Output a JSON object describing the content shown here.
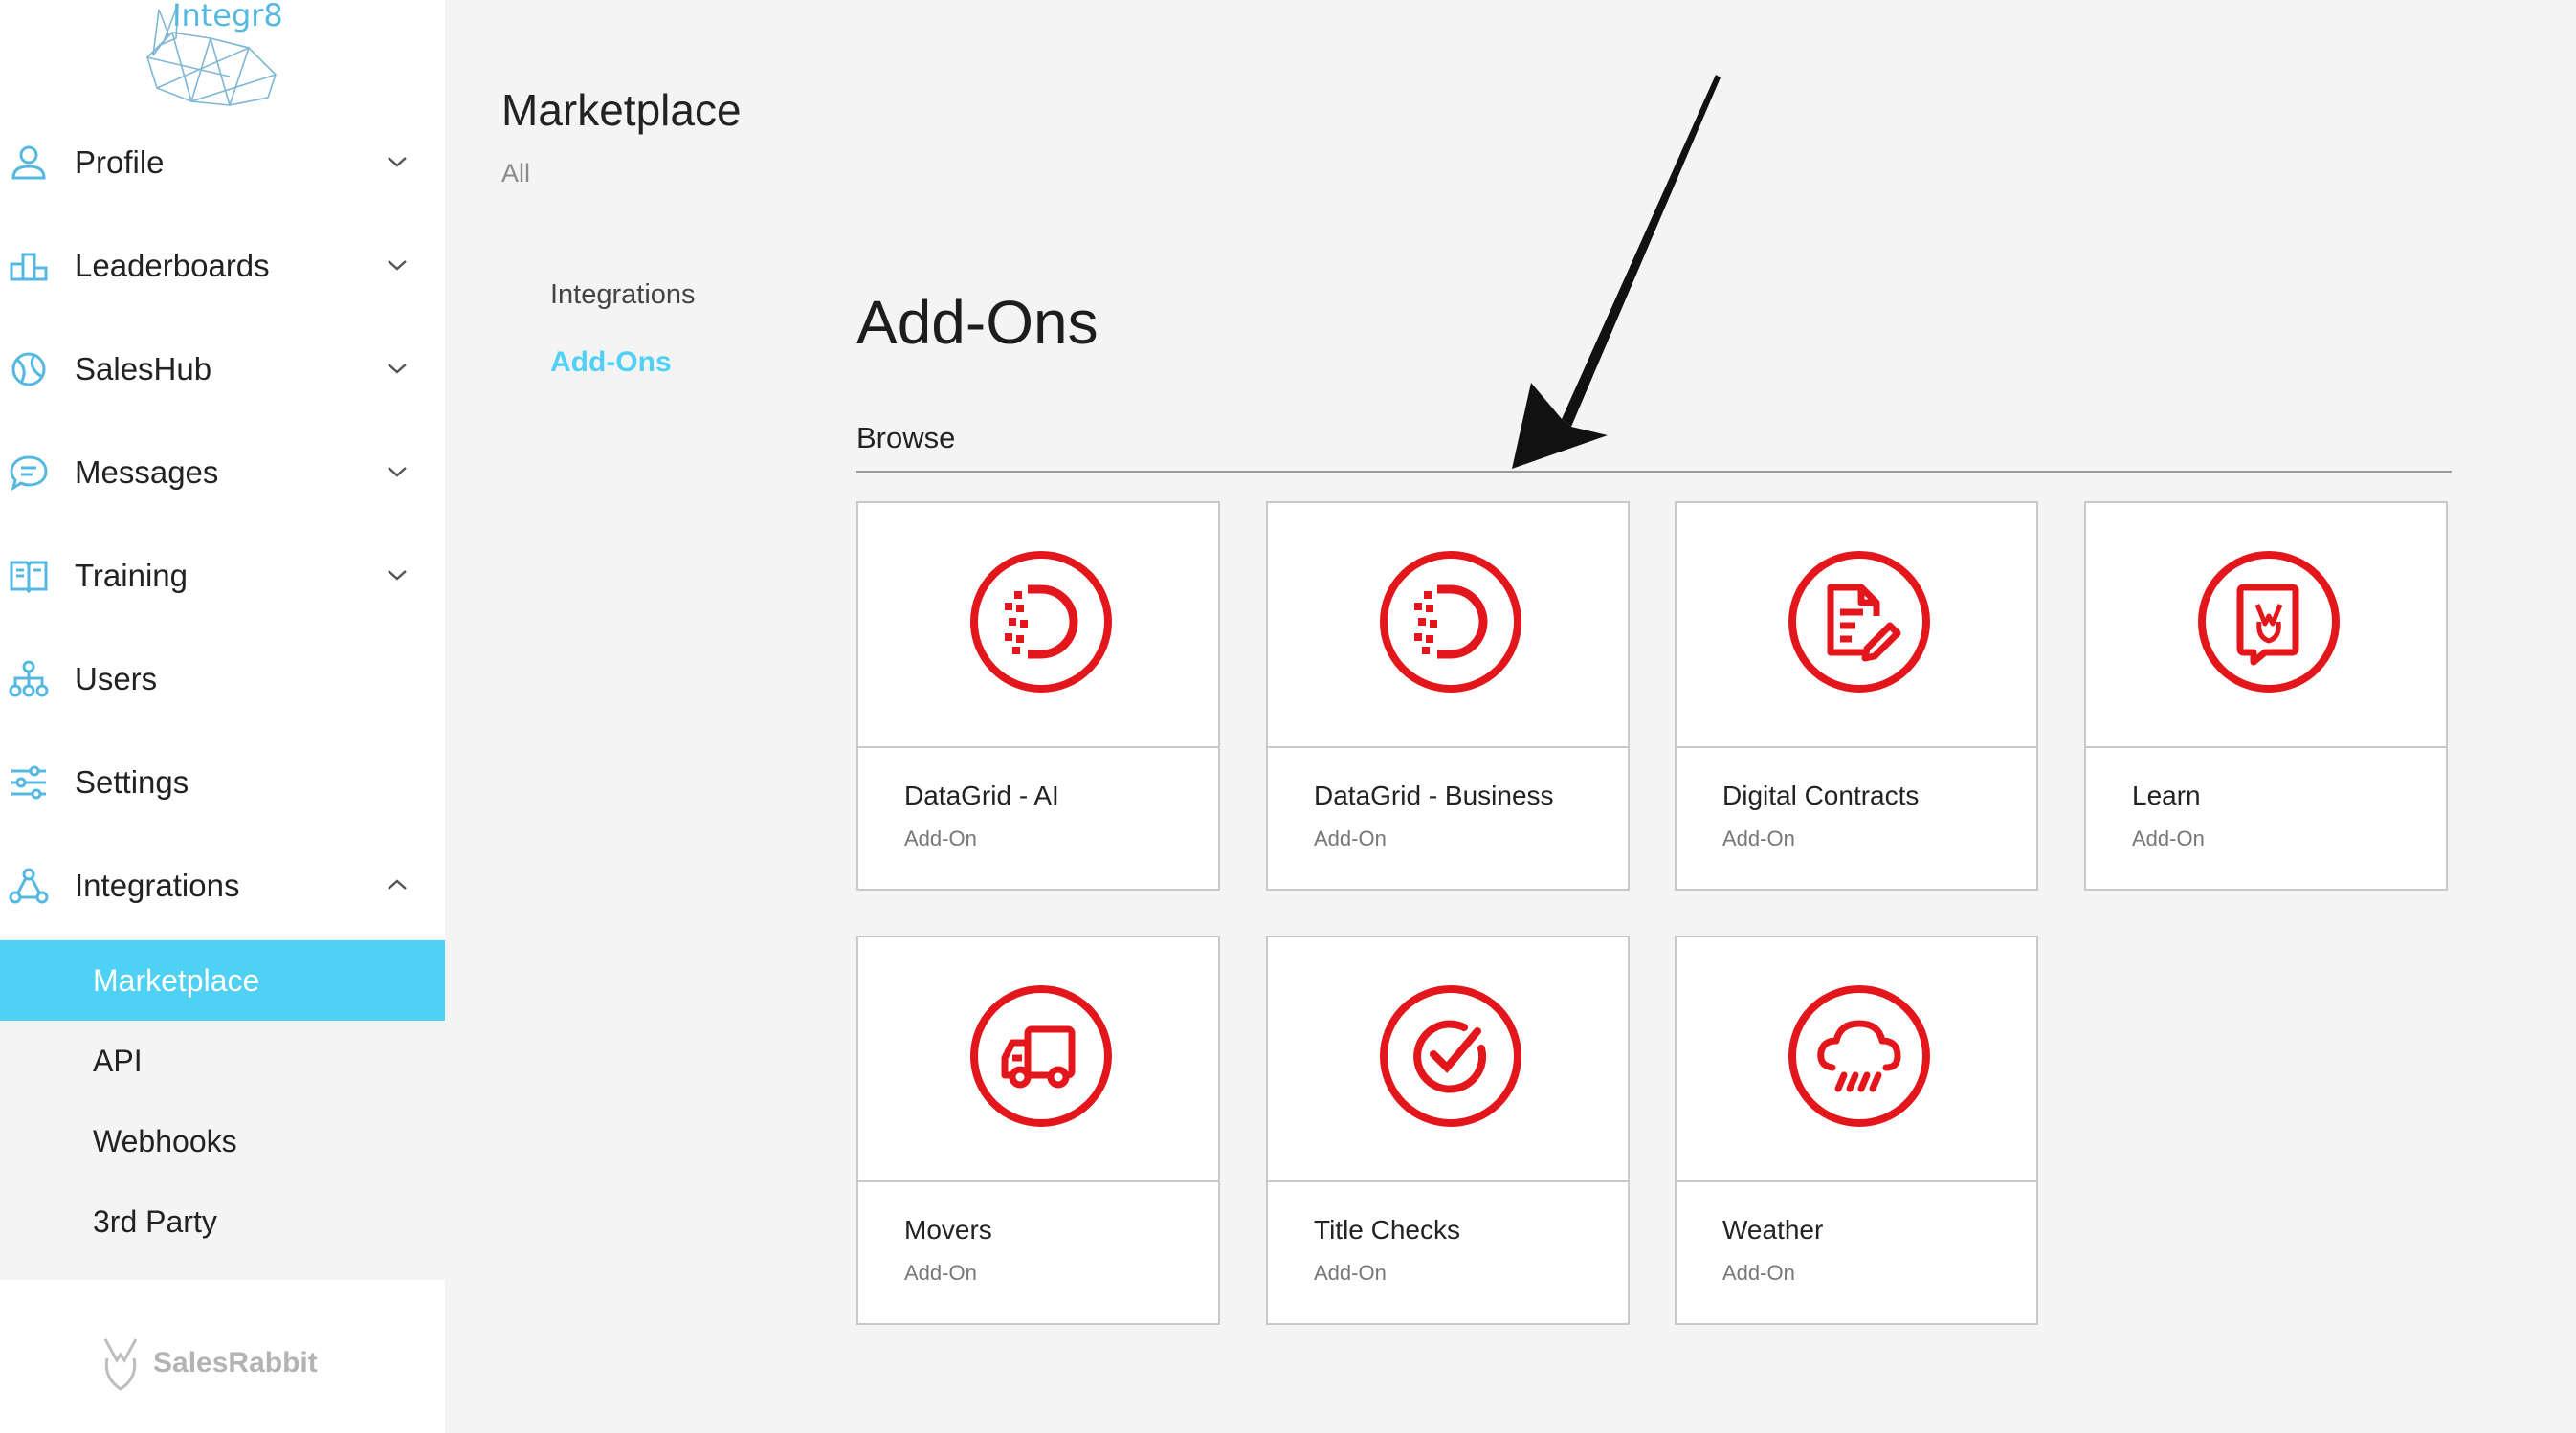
{
  "app": {
    "logo_text": "Integr8",
    "brand": "SalesRabbit"
  },
  "sidebar": {
    "items": [
      {
        "label": "Profile",
        "icon": "person-icon",
        "chevron": "down"
      },
      {
        "label": "Leaderboards",
        "icon": "podium-icon",
        "chevron": "down"
      },
      {
        "label": "SalesHub",
        "icon": "globe-icon",
        "chevron": "down"
      },
      {
        "label": "Messages",
        "icon": "chat-icon",
        "chevron": "down"
      },
      {
        "label": "Training",
        "icon": "book-icon",
        "chevron": "down"
      },
      {
        "label": "Users",
        "icon": "org-chart-icon"
      },
      {
        "label": "Settings",
        "icon": "sliders-icon"
      },
      {
        "label": "Integrations",
        "icon": "network-icon",
        "chevron": "up"
      }
    ],
    "submenu": [
      {
        "label": "Marketplace",
        "active": true
      },
      {
        "label": "API"
      },
      {
        "label": "Webhooks"
      },
      {
        "label": "3rd Party"
      }
    ]
  },
  "header": {
    "title": "Marketplace",
    "subtitle": "All"
  },
  "subnav": [
    {
      "label": "Integrations"
    },
    {
      "label": "Add-Ons",
      "active": true
    }
  ],
  "main": {
    "section_title": "Add-Ons",
    "browse_label": "Browse",
    "cards": [
      {
        "name": "DataGrid - AI",
        "type": "Add-On",
        "icon": "datagrid-icon"
      },
      {
        "name": "DataGrid - Business",
        "type": "Add-On",
        "icon": "datagrid-icon"
      },
      {
        "name": "Digital Contracts",
        "type": "Add-On",
        "icon": "contract-pen-icon"
      },
      {
        "name": "Learn",
        "type": "Add-On",
        "icon": "learn-book-icon"
      },
      {
        "name": "Movers",
        "type": "Add-On",
        "icon": "truck-icon"
      },
      {
        "name": "Title Checks",
        "type": "Add-On",
        "icon": "check-circle-icon"
      },
      {
        "name": "Weather",
        "type": "Add-On",
        "icon": "cloud-rain-icon"
      }
    ]
  },
  "colors": {
    "accent": "#4fd0f5",
    "icon_red": "#e3161b",
    "sidebar_icon": "#56b8e0"
  }
}
